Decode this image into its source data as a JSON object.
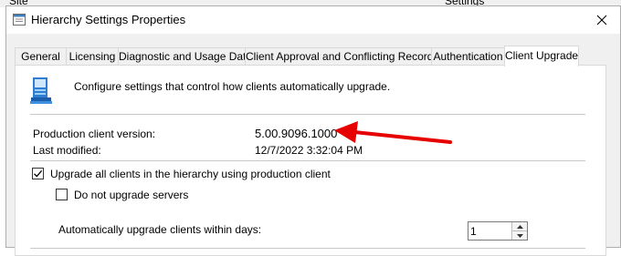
{
  "background": {
    "col1": "Site",
    "col2": "Settings"
  },
  "window": {
    "title": "Hierarchy Settings Properties"
  },
  "tabs": [
    {
      "label": "General"
    },
    {
      "label": "Licensing"
    },
    {
      "label": "Diagnostic and Usage Data"
    },
    {
      "label": "Client Approval and Conflicting Records"
    },
    {
      "label": "Authentication"
    },
    {
      "label": "Client Upgrade"
    }
  ],
  "active_tab": "Client Upgrade",
  "panel": {
    "description": "Configure settings that control how clients automatically upgrade.",
    "production_version_label": "Production client version:",
    "production_version_value": "5.00.9096.1000",
    "last_modified_label": "Last modified:",
    "last_modified_value": "12/7/2022 3:32:04 PM",
    "upgrade_all_label": "Upgrade all clients in the hierarchy using production client",
    "upgrade_all_checked": true,
    "no_servers_label": "Do not upgrade servers",
    "no_servers_checked": false,
    "days_label": "Automatically upgrade clients within days:",
    "days_value": "1"
  },
  "annotation": {
    "color": "#e60000"
  }
}
